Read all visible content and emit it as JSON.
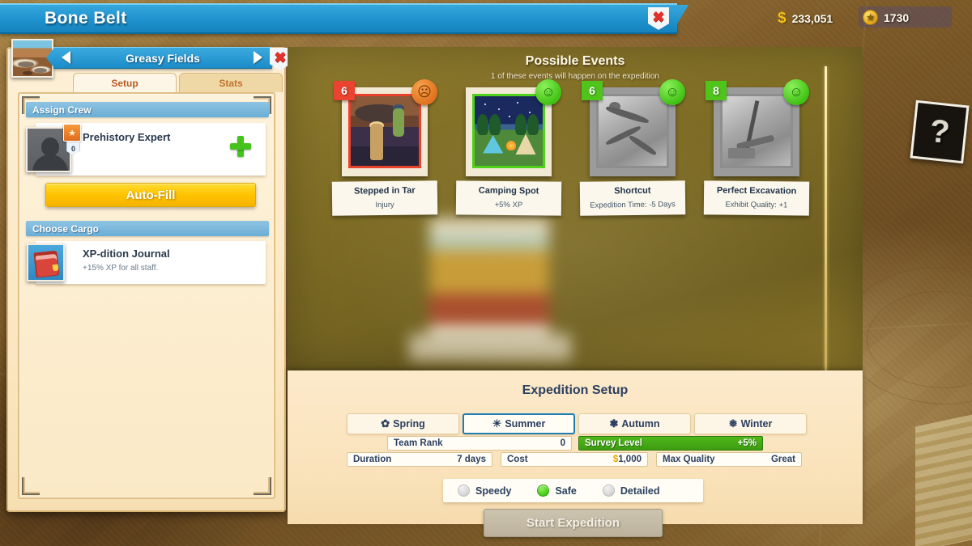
{
  "titlebar": {
    "title": "Bone Belt",
    "close_icon": "close-x-icon"
  },
  "currency": {
    "cash_icon": "dollar-coin-icon",
    "cash": "233,051",
    "ticket_icon": "token-coin-icon",
    "tickets": "1730"
  },
  "left_panel": {
    "location": {
      "name": "Greasy Fields",
      "prev_icon": "chevron-left-icon",
      "next_icon": "chevron-right-icon",
      "close_icon": "close-x-icon",
      "thumbnail_icon": "location-thumbnail-icon"
    },
    "tabs": [
      {
        "label": "Setup",
        "active": true
      },
      {
        "label": "Stats",
        "active": false
      }
    ],
    "assign_crew": {
      "header": "Assign Crew",
      "member": {
        "name": "Prehistory Expert",
        "badge_icon": "prehistory-badge-icon",
        "level": "0",
        "avatar_icon": "crew-avatar-icon",
        "add_icon": "plus-icon"
      },
      "auto_fill_label": "Auto-Fill"
    },
    "choose_cargo": {
      "header": "Choose Cargo",
      "item": {
        "name": "XP-dition Journal",
        "description": "+15% XP for all staff.",
        "icon": "journal-book-icon"
      }
    }
  },
  "events": {
    "title": "Possible Events",
    "subtitle": "1 of these events will happen on the expedition",
    "cards": [
      {
        "weight": "6",
        "badge_color": "#ea4330",
        "mood": "sad",
        "mood_icon": "sad-face-icon",
        "name": "Stepped in Tar",
        "effect": "Injury",
        "frame_color": "#e8422c",
        "grayed": false,
        "art": "tar"
      },
      {
        "weight": "",
        "badge_color": "",
        "mood": "happy",
        "mood_icon": "happy-face-icon",
        "name": "Camping Spot",
        "effect": "+5% XP",
        "frame_color": "#4fd21c",
        "grayed": false,
        "art": "camp"
      },
      {
        "weight": "6",
        "badge_color": "#4fc51c",
        "mood": "happy",
        "mood_icon": "happy-face-icon",
        "name": "Shortcut",
        "effect": "Expedition Time: -5 Days",
        "frame_color": "#8e8e8e",
        "grayed": true,
        "art": "rubble"
      },
      {
        "weight": "8",
        "badge_color": "#4fc51c",
        "mood": "happy",
        "mood_icon": "happy-face-icon",
        "name": "Perfect Excavation",
        "effect": "Exhibit Quality: +1",
        "frame_color": "#8e8e8e",
        "grayed": true,
        "art": "pick"
      }
    ]
  },
  "setup": {
    "title": "Expedition Setup",
    "seasons": [
      {
        "label": "Spring",
        "icon": "flower-icon",
        "glyph": "✿",
        "selected": false
      },
      {
        "label": "Summer",
        "icon": "sun-icon",
        "glyph": "☀",
        "selected": true
      },
      {
        "label": "Autumn",
        "icon": "leaf-icon",
        "glyph": "❃",
        "selected": false
      },
      {
        "label": "Winter",
        "icon": "snowflake-icon",
        "glyph": "❅",
        "selected": false
      }
    ],
    "stats": {
      "team_rank_label": "Team Rank",
      "team_rank_value": "0",
      "survey_level_label": "Survey Level",
      "survey_level_value": "+5%",
      "duration_label": "Duration",
      "duration_value": "7 days",
      "cost_label": "Cost",
      "cost_icon": "dollar-coin-icon",
      "cost_value": "1,000",
      "max_quality_label": "Max Quality",
      "max_quality_value": "Great"
    },
    "modes": [
      {
        "label": "Speedy",
        "selected": false
      },
      {
        "label": "Safe",
        "selected": true
      },
      {
        "label": "Detailed",
        "selected": false
      }
    ],
    "start_button": "Start Expedition"
  },
  "map": {
    "mystery_card_icon": "question-mark-icon",
    "mystery_card_glyph": "?"
  },
  "colors": {
    "accent_blue": "#1f93cf",
    "gold": "#ffc400",
    "good_green": "#4fc51c",
    "bad_red": "#ea4330",
    "parchment": "#fae3bc"
  }
}
